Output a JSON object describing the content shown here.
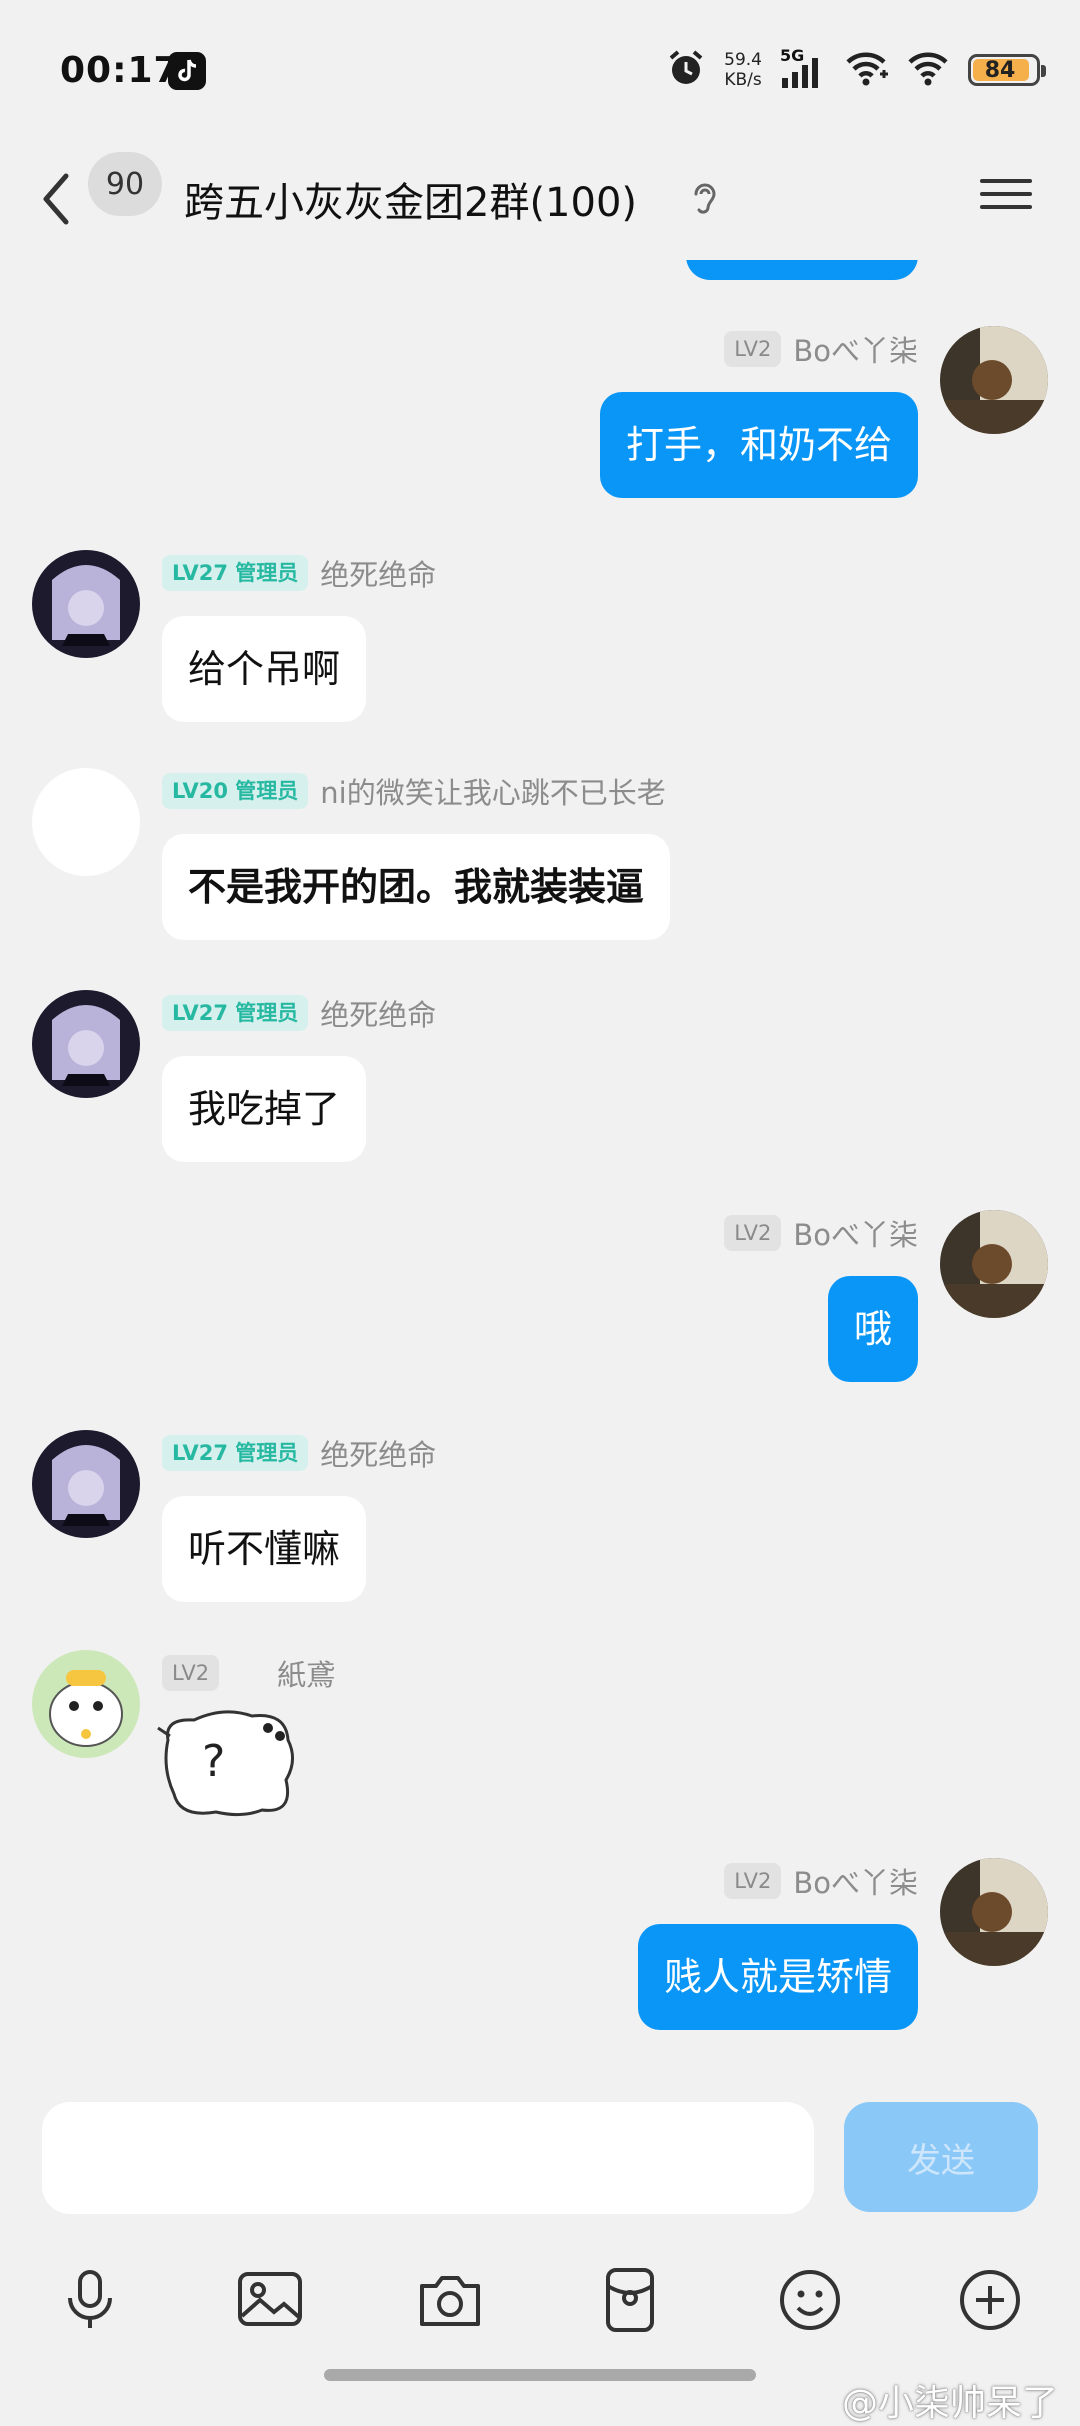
{
  "status": {
    "time": "00:17",
    "net_speed_value": "59.4",
    "net_speed_unit": "KB/s",
    "network": "5G",
    "battery": "84",
    "icons": [
      "tiktok-icon",
      "alarm-icon",
      "signal-icon",
      "wifi-icon",
      "battery-icon"
    ]
  },
  "header": {
    "unread_count": "90",
    "title": "跨五小灰灰金团2群(100)"
  },
  "messages": [
    {
      "side": "right",
      "level": "LV2",
      "role": "",
      "nickname": "Boべ丫柒",
      "text": "打手，和奶不给"
    },
    {
      "side": "left",
      "level": "LV27",
      "role": "管理员",
      "nickname": "绝死绝命",
      "text": "给个吊啊"
    },
    {
      "side": "left",
      "level": "LV20",
      "role": "管理员",
      "nickname": "ni的微笑让我心跳不已长老",
      "text": "不是我开的团。我就装装逼"
    },
    {
      "side": "left",
      "level": "LV27",
      "role": "管理员",
      "nickname": "绝死绝命",
      "text": "我吃掉了"
    },
    {
      "side": "right",
      "level": "LV2",
      "role": "",
      "nickname": "Boべ丫柒",
      "text": "哦"
    },
    {
      "side": "left",
      "level": "LV27",
      "role": "管理员",
      "nickname": "绝死绝命",
      "text": "听不懂嘛"
    },
    {
      "side": "left",
      "level": "LV2",
      "role": "",
      "nickname": "紙鳶",
      "text": "?"
    },
    {
      "side": "right",
      "level": "LV2",
      "role": "",
      "nickname": "Boべ丫柒",
      "text": "贱人就是矫情"
    }
  ],
  "input": {
    "placeholder": "",
    "send_label": "发送"
  },
  "toolbar": [
    "microphone-icon",
    "image-icon",
    "camera-icon",
    "red-packet-icon",
    "emoji-icon",
    "plus-icon"
  ],
  "watermark": "@小柒帅呆了",
  "colors": {
    "background": "#f1f1f1",
    "outgoing_bubble": "#0a96f6",
    "incoming_bubble": "#ffffff",
    "admin_badge_bg": "#d6f1ed",
    "admin_badge_text": "#27b8a2",
    "send_button": "#8ac8f8"
  }
}
